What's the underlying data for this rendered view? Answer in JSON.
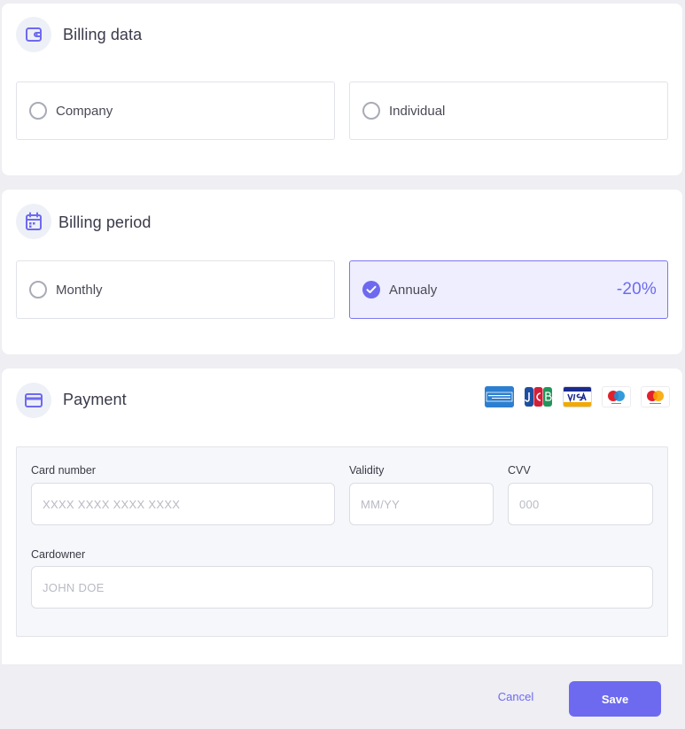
{
  "billing_data": {
    "title": "Billing data",
    "icon": "wallet-icon",
    "options": [
      {
        "label": "Company",
        "selected": false
      },
      {
        "label": "Individual",
        "selected": false
      }
    ]
  },
  "billing_period": {
    "title": "Billing period",
    "icon": "calendar-icon",
    "options": [
      {
        "label": "Monthly",
        "selected": false
      },
      {
        "label": "Annualy",
        "selected": true,
        "badge": "-20%"
      }
    ]
  },
  "payment": {
    "title": "Payment",
    "icon": "credit-card-icon",
    "card_brands": [
      "american-express-logo",
      "jcb-logo",
      "visa-logo",
      "maestro-logo",
      "mastercard-logo"
    ],
    "fields": {
      "card_number": {
        "label": "Card number",
        "placeholder": "XXXX XXXX XXXX XXXX",
        "value": ""
      },
      "validity": {
        "label": "Validity",
        "placeholder": "MM/YY",
        "value": ""
      },
      "cvv": {
        "label": "CVV",
        "placeholder": "000",
        "value": ""
      },
      "cardowner": {
        "label": "Cardowner",
        "placeholder": "JOHN DOE",
        "value": ""
      }
    }
  },
  "footer": {
    "cancel_label": "Cancel",
    "save_label": "Save"
  },
  "colors": {
    "accent": "#6d6af0",
    "selected_bg": "#eeeeff",
    "page_bg": "#eeeef3"
  }
}
